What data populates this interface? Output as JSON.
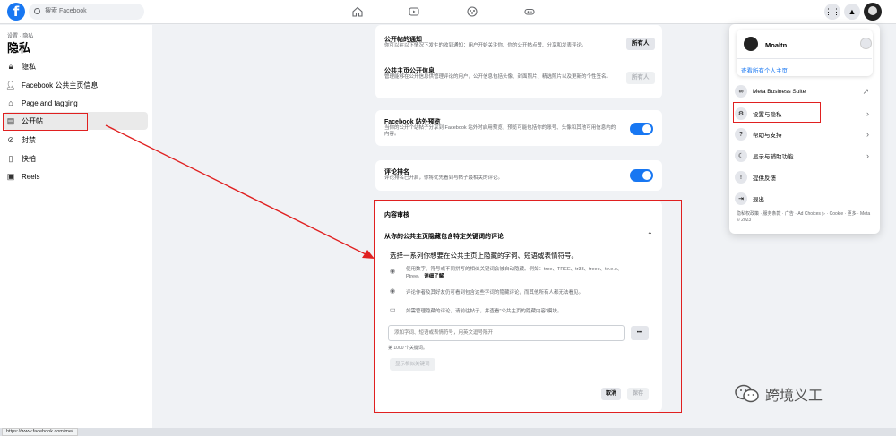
{
  "topbar": {
    "logo_letter": "f",
    "search_placeholder": "搜索 Facebook"
  },
  "sidebar": {
    "breadcrumb": "设置 · 隐私",
    "title": "隐私",
    "items": [
      {
        "label": "隐私",
        "icon": "lock-icon"
      },
      {
        "label": "Facebook 公共主页信息",
        "icon": "user-icon"
      },
      {
        "label": "Page and tagging",
        "icon": "tag-icon"
      },
      {
        "label": "公开帖",
        "icon": "post-icon"
      },
      {
        "label": "封禁",
        "icon": "block-user-icon"
      },
      {
        "label": "快拍",
        "icon": "book-icon"
      },
      {
        "label": "Reels",
        "icon": "reels-icon"
      }
    ]
  },
  "main": {
    "s1_title": "公开帖的通知",
    "s1_desc": "你可以在以下情况下发生的收到通知：用户开始关注你、你的公开帖点赞、分享和发表评论。",
    "s1_btn": "所有人",
    "s2_title": "公共主页公开信息",
    "s2_desc": "管理能够在公开信息供管理评论的用户，公开信息包括头像、封面照片、精选照片以及更新的个性签名。",
    "s2_btn": "所有人",
    "s3_title": "Facebook 站外预览",
    "s3_desc": "当你的公开个站帖子分享到 Facebook 站外时启用预览，预览可能包括你的账号、头像和其他可用信息内的内容。",
    "s4_title": "评论排名",
    "s4_desc": "评论排名已开启，你将优先看到与帖子最相关的评论。",
    "moderation": {
      "title": "内容审核",
      "subtitle": "从你的公共主页隐藏包含特定关键词的评论",
      "intro": "选择一系列你想要在公共主页上隐藏的字词、短语或表情符号。",
      "tip1": "使用数字、符号或不同拼写的相似关键词会被自动隐藏。例如：tree、TREE、tr33、treee、t.r.e.e、Ptree。",
      "tip1_link": "详细了解",
      "tip2": "评论作者及其好友仍可看到包含这些字词的隐藏评论，而其他所有人都无法看见。",
      "tip3": "如需管理隐藏的评论，请前往帖子，并查看\"公共主页的隐藏内容\"模块。",
      "input_placeholder": "添加字词、短语或表情符号，用英文逗号隔开",
      "more_btn": "•••",
      "counter": "第 1000 个关键词。",
      "add_btn": "显示相似关键词",
      "cancel_btn": "取消",
      "save_btn": "保存"
    }
  },
  "dropdown": {
    "profile_name": "Moaltn",
    "view_all": "查看所有个人主页",
    "items": [
      {
        "label": "Meta Business Suite",
        "icon": "meta-icon",
        "arrow": "↗"
      },
      {
        "label": "设置与隐私",
        "icon": "gear-icon",
        "arrow": "›"
      },
      {
        "label": "帮助与支持",
        "icon": "help-icon",
        "arrow": "›"
      },
      {
        "label": "显示与辅助功能",
        "icon": "moon-icon",
        "arrow": "›"
      },
      {
        "label": "提供反馈",
        "icon": "feedback-icon",
        "arrow": ""
      },
      {
        "label": "退出",
        "icon": "logout-icon",
        "arrow": ""
      }
    ],
    "footer": "隐私权政策 · 服务条款 · 广告 · Ad Choices ▷ · Cookie · 更多 · Meta © 2023"
  },
  "statusbar": {
    "url": "https://www.facebook.com/me/"
  },
  "watermark": {
    "text": "跨境义工"
  },
  "colors": {
    "accent": "#1877f2",
    "annotation_red": "#e02020"
  }
}
